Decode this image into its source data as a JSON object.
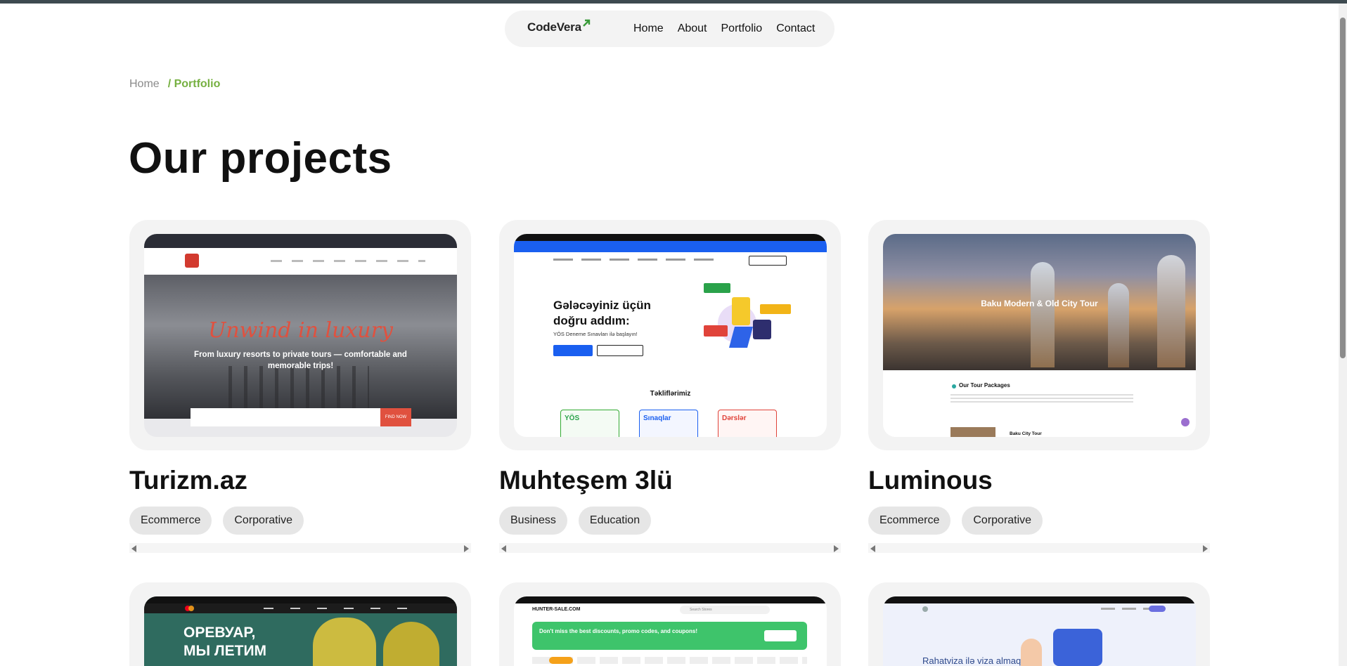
{
  "nav": {
    "logo": "CodeVera",
    "links": [
      "Home",
      "About",
      "Portfolio",
      "Contact"
    ]
  },
  "breadcrumb": {
    "home": "Home",
    "current": "/ Portfolio"
  },
  "page_title": "Our projects",
  "projects": [
    {
      "title": "Turizm.az",
      "tags": [
        "Ecommerce",
        "Corporative"
      ],
      "preview": {
        "headline": "Unwind in luxury",
        "subtitle": "From luxury resorts to private tours — comfortable and memorable trips!",
        "cta": "FIND NOW"
      }
    },
    {
      "title": "Muhteşem 3lü",
      "tags": [
        "Business",
        "Education"
      ],
      "preview": {
        "headline_1": "Gələcəyiniz üçün",
        "headline_2": "doğru addım:",
        "subtitle": "YÖS Deneme Sınavları ilə başlayın!",
        "section": "Təkliflərimiz",
        "offers": [
          "YÖS",
          "Sınaqlar",
          "Dərslər"
        ]
      }
    },
    {
      "title": "Luminous",
      "tags": [
        "Ecommerce",
        "Corporative"
      ],
      "preview": {
        "hero": "Baku Modern & Old City Tour",
        "section": "Our Tour Packages",
        "item": "Baku City Tour"
      }
    },
    {
      "preview": {
        "headline_1": "ОРЕВУАР,",
        "headline_2": "МЫ ЛЕТИМ"
      }
    },
    {
      "preview": {
        "logo": "HUNTER-SALE.COM",
        "banner": "Don't miss the best discounts, promo codes, and coupons!",
        "search": "Search Stores"
      }
    },
    {
      "preview": {
        "headline": "Rahatviza ilə viza almaq"
      }
    }
  ],
  "colors": {
    "accent": "#76b041",
    "nav_bg": "#f3f3f3",
    "card_bg": "#f3f3f3",
    "tag_bg": "#e6e6e6"
  }
}
